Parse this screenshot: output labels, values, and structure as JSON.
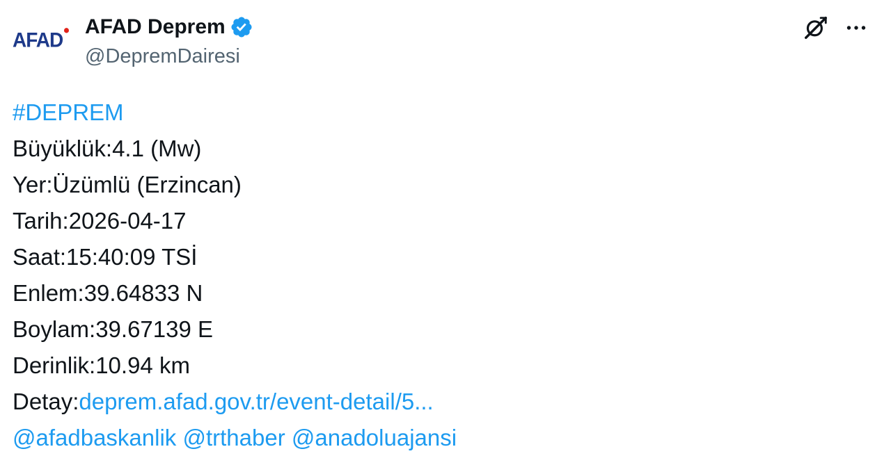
{
  "account": {
    "logo_text": "AFAD",
    "display_name": "AFAD Deprem",
    "handle": "@DepremDairesi",
    "verified_icon": "verified-badge-icon",
    "verified_color": "#1d9bf0"
  },
  "actions": {
    "grok_icon": "grok-icon",
    "more_icon": "more-horizontal-icon"
  },
  "tweet": {
    "hashtag": "#DEPREM",
    "lines": [
      "Büyüklük:4.1 (Mw)",
      "Yer:Üzümlü (Erzincan)",
      "Tarih:2026-04-17",
      "Saat:15:40:09 TSİ",
      "Enlem:39.64833 N",
      "Boylam:39.67139 E",
      "Derinlik:10.94 km"
    ],
    "detail_label": "Detay:",
    "detail_link": "deprem.afad.gov.tr/event-detail/5...",
    "mentions": [
      "@afadbaskanlik",
      "@trthaber",
      "@anadoluajansi"
    ]
  },
  "colors": {
    "text": "#0f1419",
    "secondary": "#536471",
    "link": "#1d9bf0",
    "logo_blue": "#1e3a8a",
    "logo_red": "#e2231a"
  }
}
